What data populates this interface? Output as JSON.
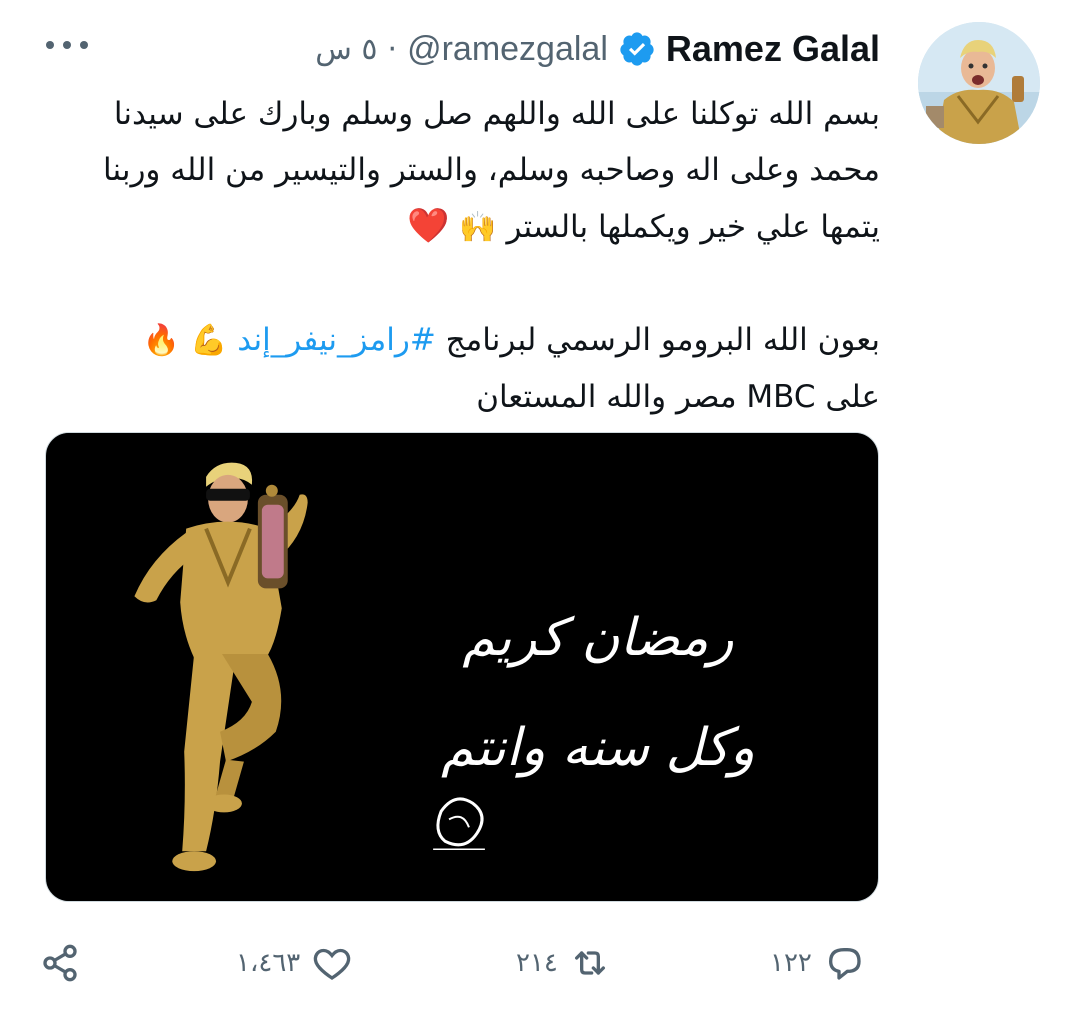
{
  "author": {
    "display_name": "Ramez Galal",
    "handle": "@ramezgalal",
    "separator": "·",
    "time_ago": "٥ س",
    "verified_icon": "verified-badge-icon",
    "avatar_icon": "profile-avatar"
  },
  "more_icon": "more-options-icon",
  "tweet": {
    "line1": "بسم الله توكلنا على الله واللهم صل وسلم وبارك على سيدنا",
    "line2": "محمد وعلى اله وصاحبه وسلم، والستر والتيسير من الله وربنا",
    "line3_text": "يتمها علي خير ويكملها بالستر",
    "line3_emoji_hands": "🙌",
    "line3_emoji_heart": "❤️",
    "line4_text": "بعون الله البرومو الرسمي لبرنامج",
    "line4_hashtag": "#رامز_نيفر_إند",
    "line4_emoji_muscle": "💪",
    "line4_emoji_fire": "🔥",
    "line5": "على MBC مصر والله المستعان"
  },
  "media": {
    "greeting_line1": "رمضان كريم",
    "greeting_line2": "وكل سنه وانتم",
    "logo_text": "رمضان"
  },
  "actions": {
    "reply_icon": "reply-icon",
    "reply_count": "١٢٢",
    "retweet_icon": "retweet-icon",
    "retweet_count": "٢١٤",
    "like_icon": "heart-icon",
    "like_count": "١،٤٦٣",
    "share_icon": "share-icon"
  },
  "colors": {
    "text_primary": "#0f1419",
    "text_secondary": "#536471",
    "accent": "#1d9bf0",
    "media_background": "#000000",
    "costume_gold": "#c9a24a"
  }
}
